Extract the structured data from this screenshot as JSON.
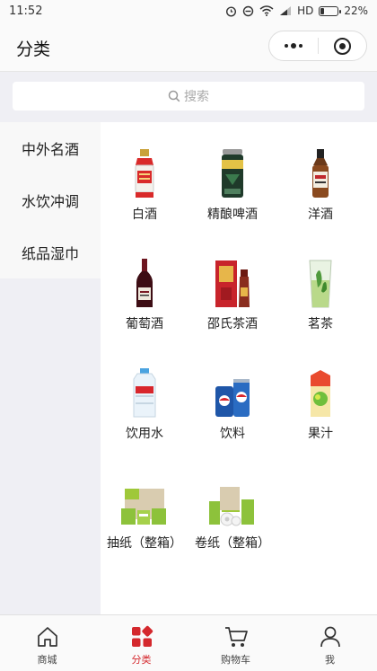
{
  "status_bar": {
    "time": "11:52",
    "network": "HD",
    "battery": "22%",
    "battery_level": 0.22
  },
  "nav": {
    "title": "分类"
  },
  "search": {
    "placeholder": "搜索"
  },
  "sidebar": {
    "items": [
      {
        "label": "中外名酒"
      },
      {
        "label": "水饮冲调"
      },
      {
        "label": "纸品湿巾"
      }
    ]
  },
  "categories": [
    {
      "label": "白酒",
      "icon": "baijiu-bottle-icon"
    },
    {
      "label": "精酿啤酒",
      "icon": "beer-can-icon"
    },
    {
      "label": "洋酒",
      "icon": "whisky-bottle-icon"
    },
    {
      "label": "葡萄酒",
      "icon": "wine-bottle-icon"
    },
    {
      "label": "邵氏茶酒",
      "icon": "tea-liquor-box-icon"
    },
    {
      "label": "茗茶",
      "icon": "green-tea-glass-icon"
    },
    {
      "label": "饮用水",
      "icon": "water-jug-icon"
    },
    {
      "label": "饮料",
      "icon": "soda-can-icon"
    },
    {
      "label": "果汁",
      "icon": "juice-box-icon"
    },
    {
      "label": "抽纸（整箱）",
      "icon": "tissue-box-icon"
    },
    {
      "label": "卷纸（整箱）",
      "icon": "toilet-roll-icon"
    }
  ],
  "tabs": [
    {
      "label": "商城",
      "icon": "home-icon"
    },
    {
      "label": "分类",
      "icon": "category-icon"
    },
    {
      "label": "购物车",
      "icon": "cart-icon"
    },
    {
      "label": "我",
      "icon": "user-icon"
    }
  ],
  "colors": {
    "accent": "#d4282d",
    "sidebar_bg": "#efeff4",
    "active_item_bg": "#f8f8f8"
  }
}
